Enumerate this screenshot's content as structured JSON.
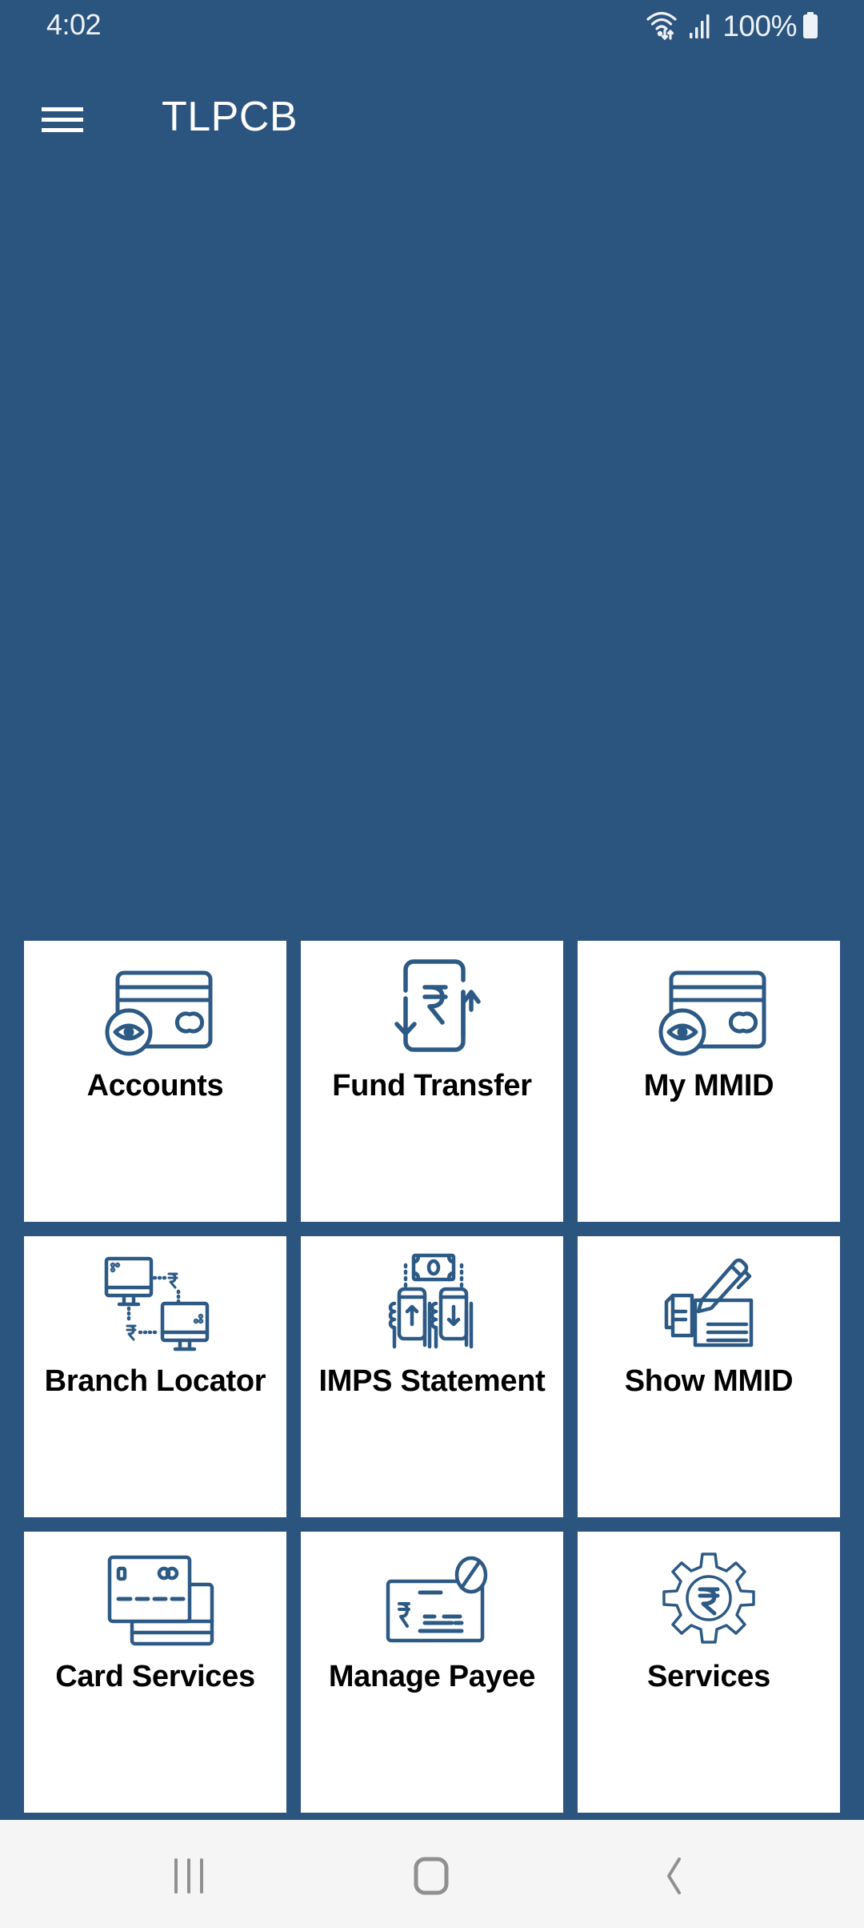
{
  "status_bar": {
    "time": "4:02",
    "battery_percent": "100%",
    "icons": [
      "wifi-icon",
      "signal-icon",
      "battery-icon"
    ]
  },
  "toolbar": {
    "menu_icon": "hamburger-menu-icon",
    "title": "TLPCB"
  },
  "colors": {
    "primary": "#2B547F",
    "tile_background": "#FFFFFF",
    "icon_stroke": "#2C5A85",
    "label_text": "#000000",
    "nav_bar_background": "#F5F5F5"
  },
  "tiles": [
    {
      "label": "Accounts",
      "icon": "card-eye-icon"
    },
    {
      "label": "Fund Transfer",
      "icon": "rupee-transfer-icon"
    },
    {
      "label": "My MMID",
      "icon": "card-eye-icon"
    },
    {
      "label": "Branch Locator",
      "icon": "computers-network-icon"
    },
    {
      "label": "IMPS Statement",
      "icon": "mobile-money-transfer-icon"
    },
    {
      "label": "Show MMID",
      "icon": "document-pen-icon"
    },
    {
      "label": "Card Services",
      "icon": "credit-cards-icon"
    },
    {
      "label": "Manage Payee",
      "icon": "cheque-blocked-icon"
    },
    {
      "label": "Services",
      "icon": "rupee-gear-icon"
    }
  ],
  "nav_bar": {
    "recents": "recents-icon",
    "home": "home-icon",
    "back": "back-icon"
  }
}
